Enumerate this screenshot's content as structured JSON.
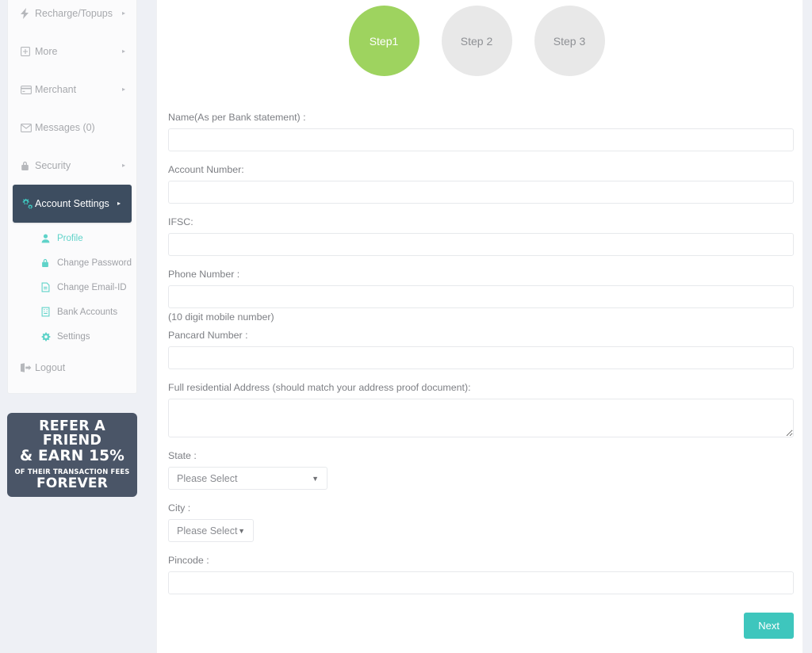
{
  "sidebar": {
    "items": [
      {
        "label": "Recharge/Topups",
        "icon": "bolt-icon",
        "caret": "▸",
        "active": false
      },
      {
        "label": "More",
        "icon": "plus-square-icon",
        "caret": "▸",
        "active": false
      },
      {
        "label": "Merchant",
        "icon": "credit-card-icon",
        "caret": "▸",
        "active": false
      },
      {
        "label": "Messages (0)",
        "icon": "envelope-icon",
        "caret": "",
        "active": false
      },
      {
        "label": "Security",
        "icon": "lock-icon",
        "caret": "▸",
        "active": false
      },
      {
        "label": "Account Settings",
        "icon": "cogs-icon",
        "caret": "▸",
        "active": true
      }
    ],
    "submenu": [
      {
        "label": "Profile",
        "icon": "user-icon",
        "current": true
      },
      {
        "label": "Change Password",
        "icon": "lock-icon",
        "current": false
      },
      {
        "label": "Change Email-ID",
        "icon": "file-text-icon",
        "current": false
      },
      {
        "label": "Bank Accounts",
        "icon": "building-icon",
        "current": false
      },
      {
        "label": "Settings",
        "icon": "gear-icon",
        "current": false
      }
    ],
    "logout": {
      "label": "Logout",
      "icon": "sign-out-icon"
    }
  },
  "refer_banner": {
    "line1": "REFER A FRIEND",
    "line2": "& EARN 15%",
    "line3": "OF THEIR TRANSACTION FEES",
    "line4": "FOREVER",
    "background": "#4a5567"
  },
  "steps": [
    {
      "label": "Step1",
      "state": "active",
      "color": "#9ed35f"
    },
    {
      "label": "Step 2",
      "state": "inactive",
      "color": "#e8e8e8"
    },
    {
      "label": "Step 3",
      "state": "inactive",
      "color": "#e8e8e8"
    }
  ],
  "form": {
    "name_label": "Name(As per Bank statement) :",
    "name_value": "",
    "account_label": "Account Number:",
    "account_value": "",
    "ifsc_label": "IFSC:",
    "ifsc_value": "",
    "phone_label": "Phone Number :",
    "phone_value": "",
    "phone_hint": "(10 digit mobile number)",
    "pancard_label": "Pancard Number :",
    "pancard_value": "",
    "address_label": "Full residential Address (should match your address proof document):",
    "address_value": "",
    "state_label": "State :",
    "state_value": "Please Select",
    "city_label": "City :",
    "city_value": "Please Select",
    "pincode_label": "Pincode :",
    "pincode_value": "",
    "select_arrow": "▼"
  },
  "actions": {
    "next_label": "Next",
    "next_color": "#3ec6bd"
  }
}
